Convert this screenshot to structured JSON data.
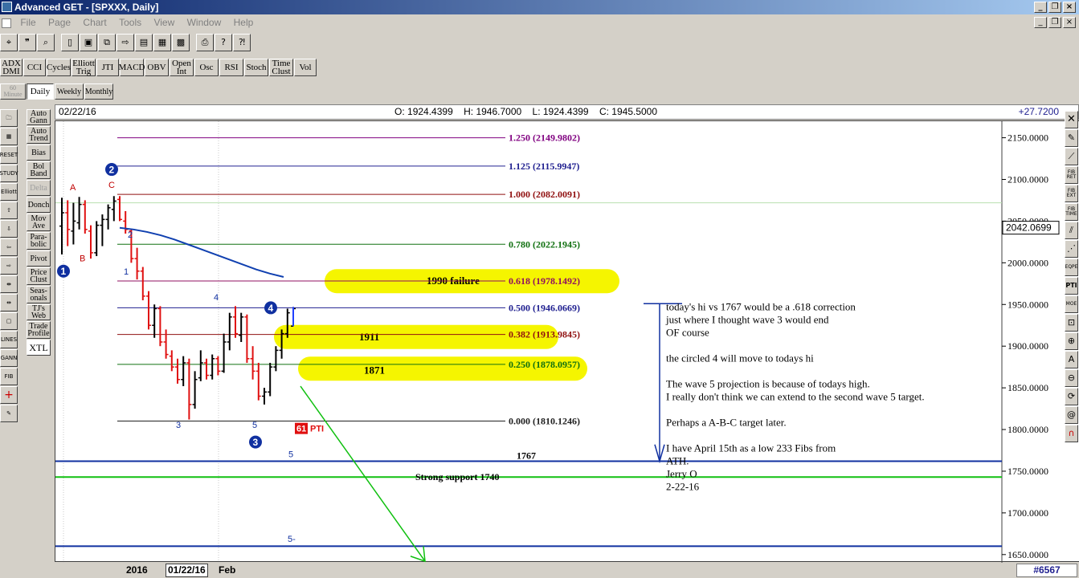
{
  "window": {
    "title": "Advanced GET - [SPXXX, Daily]"
  },
  "menu": [
    "File",
    "Page",
    "Chart",
    "Tools",
    "View",
    "Window",
    "Help"
  ],
  "indicator_buttons": [
    {
      "label": "ADX DMI",
      "l1": "ADX",
      "l2": "DMI"
    },
    {
      "label": "CCI",
      "l1": "CCI",
      "l2": ""
    },
    {
      "label": "Cycles",
      "l1": "Cycles",
      "l2": ""
    },
    {
      "label": "Elliott Trig",
      "l1": "Elliott",
      "l2": "Trig"
    },
    {
      "label": "JTI",
      "l1": "JTI",
      "l2": ""
    },
    {
      "label": "MACD",
      "l1": "MACD",
      "l2": ""
    },
    {
      "label": "OBV",
      "l1": "OBV",
      "l2": ""
    },
    {
      "label": "Open Int",
      "l1": "Open",
      "l2": "Int"
    },
    {
      "label": "Osc",
      "l1": "Osc",
      "l2": ""
    },
    {
      "label": "RSI",
      "l1": "RSI",
      "l2": ""
    },
    {
      "label": "Stoch",
      "l1": "Stoch",
      "l2": ""
    },
    {
      "label": "Time Clust",
      "l1": "Time",
      "l2": "Clust"
    },
    {
      "label": "Vol",
      "l1": "Vol",
      "l2": ""
    }
  ],
  "periods": {
    "minute_l1": "60",
    "minute_l2": "Minute",
    "daily": "Daily",
    "weekly": "Weekly",
    "monthly": "Monthly"
  },
  "study_buttons": [
    {
      "l1": "Auto",
      "l2": "Gann",
      "dis": false
    },
    {
      "l1": "Auto",
      "l2": "Trend",
      "dis": false
    },
    {
      "l1": "Bias",
      "l2": "",
      "dis": false
    },
    {
      "l1": "Bol",
      "l2": "Band",
      "dis": false
    },
    {
      "l1": "Delta",
      "l2": "",
      "dis": true
    },
    {
      "l1": "Donch",
      "l2": "",
      "dis": false
    },
    {
      "l1": "Mov",
      "l2": "Ave",
      "dis": false
    },
    {
      "l1": "Para-",
      "l2": "bolic",
      "dis": false
    },
    {
      "l1": "Pivot",
      "l2": "",
      "dis": false
    },
    {
      "l1": "Price",
      "l2": "Clust",
      "dis": false
    },
    {
      "l1": "Seas-",
      "l2": "onals",
      "dis": false
    },
    {
      "l1": "TJ's",
      "l2": "Web",
      "dis": false
    },
    {
      "l1": "Trade",
      "l2": "Profile",
      "dis": false
    },
    {
      "l1": "XTL",
      "l2": "",
      "dis": false
    }
  ],
  "left_tools": [
    "RESET",
    "STUDY",
    "Elliott",
    "LINES",
    "GANN",
    "FIB"
  ],
  "right_tools": [
    "FIB RET",
    "FIB EXT",
    "FIB TIME",
    "EQPE",
    "PTI",
    "MOE",
    "A"
  ],
  "header": {
    "date": "02/22/16",
    "open_label": "O:",
    "open": "1924.4399",
    "high_label": "H:",
    "high": "1946.7000",
    "low_label": "L:",
    "low": "1924.4399",
    "close_label": "C:",
    "close": "1945.5000",
    "change": "+27.7200"
  },
  "footer": {
    "year": "2016",
    "cursor_date": "01/22/16",
    "month": "Feb",
    "bars": "#6567"
  },
  "colors": {
    "bull": "#000000",
    "bear": "#e01010",
    "wave_blue": "#1030a0",
    "highlight": "#f5f500",
    "support": "#10c010",
    "ma": "#1040b0"
  },
  "chart_data": {
    "type": "ohlc",
    "symbol": "SPXXX",
    "interval": "Daily",
    "ylim": [
      1645,
      2165
    ],
    "y_ticks": [
      "2150.0000",
      "2100.0000",
      "2050.0000",
      "2000.0000",
      "1950.0000",
      "1900.0000",
      "1850.0000",
      "1800.0000",
      "1750.0000",
      "1700.0000",
      "1650.0000"
    ],
    "y_tick_values": [
      2150,
      2100,
      2050,
      2000,
      1950,
      1900,
      1850,
      1800,
      1750,
      1700,
      1650
    ],
    "current_price_tag": "2042.0699",
    "current_price": 2042.07,
    "fib_levels": [
      {
        "ratio": "1.250",
        "price": "(2149.9802)",
        "value": 2149.98,
        "color": "#800080"
      },
      {
        "ratio": "1.125",
        "price": "(2115.9947)",
        "value": 2115.99,
        "color": "#202090"
      },
      {
        "ratio": "1.000",
        "price": "(2082.0091)",
        "value": 2082.01,
        "color": "#901010"
      },
      {
        "ratio": "0.780",
        "price": "(2022.1945)",
        "value": 2022.19,
        "color": "#107010"
      },
      {
        "ratio": "0.618",
        "price": "(1978.1492)",
        "value": 1978.15,
        "color": "#901060"
      },
      {
        "ratio": "0.500",
        "price": "(1946.0669)",
        "value": 1946.07,
        "color": "#202090"
      },
      {
        "ratio": "0.382",
        "price": "(1913.9845)",
        "value": 1913.98,
        "color": "#901010"
      },
      {
        "ratio": "0.250",
        "price": "(1878.0957)",
        "value": 1878.1,
        "color": "#107010"
      },
      {
        "ratio": "0.000",
        "price": "(1810.1246)",
        "value": 1810.12,
        "color": "#202020"
      }
    ],
    "highlight_notes": [
      {
        "text": "1990 failure",
        "value": 1978
      },
      {
        "text": "1911",
        "value": 1911
      },
      {
        "text": "1871",
        "value": 1873
      }
    ],
    "horizontal_lines": [
      {
        "label": "1767",
        "value": 1762,
        "color": "#1030a0"
      },
      {
        "label": "Strong support 1740",
        "value": 1743,
        "color": "#10c010"
      },
      {
        "label": "",
        "value": 1660,
        "color": "#1030a0"
      }
    ],
    "wave_labels": [
      "1",
      "2",
      "3",
      "4",
      "5",
      "A",
      "B",
      "C"
    ],
    "pti": {
      "value": "61",
      "label": "PTI"
    },
    "bars": [
      [
        2044,
        2078,
        2010,
        2060
      ],
      [
        2060,
        2075,
        2020,
        2040
      ],
      [
        2038,
        2072,
        2022,
        2050
      ],
      [
        2048,
        2079,
        2040,
        2070
      ],
      [
        2070,
        2075,
        2035,
        2040
      ],
      [
        2038,
        2045,
        2005,
        2012
      ],
      [
        2012,
        2050,
        2008,
        2045
      ],
      [
        2045,
        2058,
        2020,
        2052
      ],
      [
        2052,
        2070,
        2040,
        2066
      ],
      [
        2064,
        2080,
        2050,
        2074
      ],
      [
        2076,
        2080,
        2050,
        2052
      ],
      [
        2050,
        2062,
        2035,
        2040
      ],
      [
        2038,
        2040,
        2000,
        2005
      ],
      [
        2005,
        2018,
        1980,
        1990
      ],
      [
        1990,
        1995,
        1955,
        1960
      ],
      [
        1960,
        1966,
        1920,
        1925
      ],
      [
        1925,
        1950,
        1910,
        1945
      ],
      [
        1945,
        1948,
        1900,
        1905
      ],
      [
        1905,
        1920,
        1885,
        1890
      ],
      [
        1888,
        1895,
        1870,
        1875
      ],
      [
        1875,
        1885,
        1855,
        1860
      ],
      [
        1860,
        1888,
        1852,
        1880
      ],
      [
        1880,
        1885,
        1812,
        1830
      ],
      [
        1830,
        1870,
        1825,
        1860
      ],
      [
        1862,
        1895,
        1858,
        1880
      ],
      [
        1880,
        1885,
        1860,
        1865
      ],
      [
        1865,
        1890,
        1860,
        1885
      ],
      [
        1885,
        1888,
        1865,
        1870
      ],
      [
        1870,
        1915,
        1868,
        1905
      ],
      [
        1905,
        1940,
        1895,
        1935
      ],
      [
        1935,
        1948,
        1910,
        1915
      ],
      [
        1913,
        1940,
        1905,
        1935
      ],
      [
        1935,
        1938,
        1880,
        1885
      ],
      [
        1885,
        1900,
        1860,
        1870
      ],
      [
        1870,
        1880,
        1835,
        1840
      ],
      [
        1840,
        1850,
        1830,
        1845
      ],
      [
        1845,
        1880,
        1840,
        1875
      ],
      [
        1875,
        1900,
        1870,
        1895
      ],
      [
        1895,
        1920,
        1885,
        1915
      ],
      [
        1915,
        1945,
        1910,
        1940
      ],
      [
        1924,
        1947,
        1924,
        1945
      ]
    ],
    "moving_average": [
      2042,
      2040,
      2037,
      2033,
      2028,
      2022,
      2016,
      2010,
      2004,
      1998,
      1992,
      1987,
      1983
    ],
    "annotations": [
      "today's hi  vs  1767 would be a .618 correction",
      "just where I thought wave 3 would end",
      "OF course",
      "",
      " the circled 4 will move to todays hi",
      "",
      "The wave 5 projection is because of todays high.",
      "I really don't think we can extend to the second wave 5 target.",
      "",
      "Perhaps a A-B-C target later.",
      "",
      "I have April 15th as a low 233 Fibs from",
      "ATH.",
      "Jerry O",
      "2-22-16"
    ]
  }
}
